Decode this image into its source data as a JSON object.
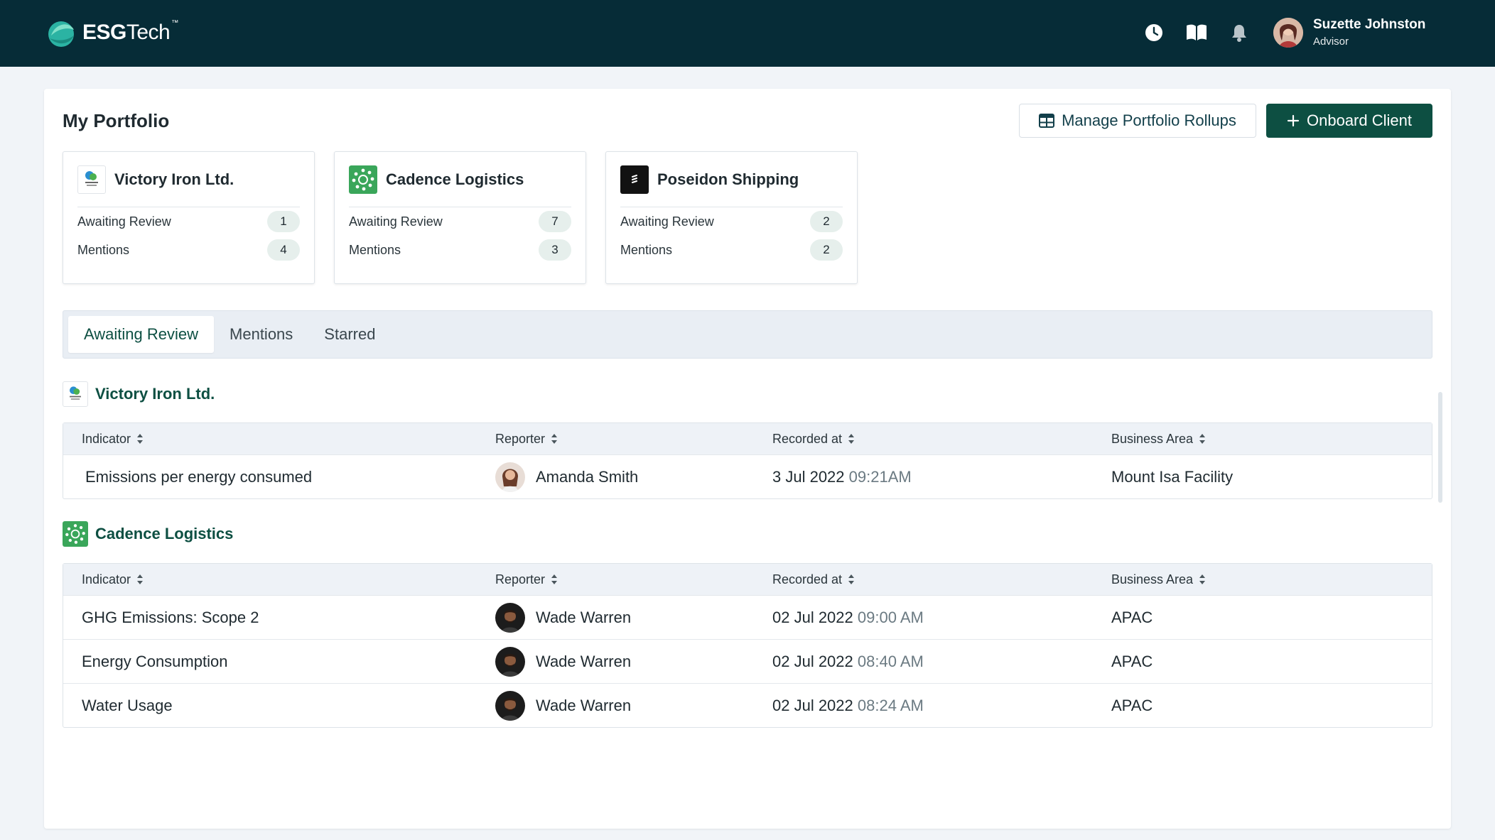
{
  "app": {
    "logo_text_bold": "ESG",
    "logo_text_light": "Tech",
    "logo_tm": "™"
  },
  "header": {
    "icons": [
      "history-icon",
      "book-icon",
      "bell-icon"
    ],
    "user": {
      "name": "Suzette Johnston",
      "role": "Advisor"
    }
  },
  "page": {
    "title": "My Portfolio",
    "manage_label": "Manage Portfolio Rollups",
    "onboard_label": "Onboard Client"
  },
  "cards": [
    {
      "name": "Victory Iron Ltd.",
      "awaiting_label": "Awaiting Review",
      "awaiting": "1",
      "mentions_label": "Mentions",
      "mentions": "4"
    },
    {
      "name": "Cadence Logistics",
      "awaiting_label": "Awaiting Review",
      "awaiting": "7",
      "mentions_label": "Mentions",
      "mentions": "3"
    },
    {
      "name": "Poseidon Shipping",
      "awaiting_label": "Awaiting Review",
      "awaiting": "2",
      "mentions_label": "Mentions",
      "mentions": "2"
    }
  ],
  "tabs": [
    "Awaiting Review",
    "Mentions",
    "Starred"
  ],
  "columns": {
    "indicator": "Indicator",
    "reporter": "Reporter",
    "recorded": "Recorded at",
    "area": "Business Area"
  },
  "groups": [
    {
      "name": "Victory Iron Ltd.",
      "rows": [
        {
          "indicator": "Emissions per energy consumed",
          "reporter": "Amanda Smith",
          "date": "3 Jul 2022",
          "time": "09:21AM",
          "area": "Mount Isa Facility"
        }
      ]
    },
    {
      "name": "Cadence Logistics",
      "rows": [
        {
          "indicator": "GHG Emissions: Scope 2",
          "reporter": "Wade Warren",
          "date": "02 Jul 2022",
          "time": "09:00 AM",
          "area": "APAC"
        },
        {
          "indicator": "Energy Consumption",
          "reporter": "Wade Warren",
          "date": "02 Jul 2022",
          "time": "08:40 AM",
          "area": "APAC"
        },
        {
          "indicator": "Water Usage",
          "reporter": "Wade Warren",
          "date": "02 Jul 2022",
          "time": "08:24 AM",
          "area": "APAC"
        }
      ]
    }
  ],
  "colors": {
    "topbar": "#062c37",
    "primary": "#0d4f42",
    "accent_green": "#3aa65a"
  }
}
